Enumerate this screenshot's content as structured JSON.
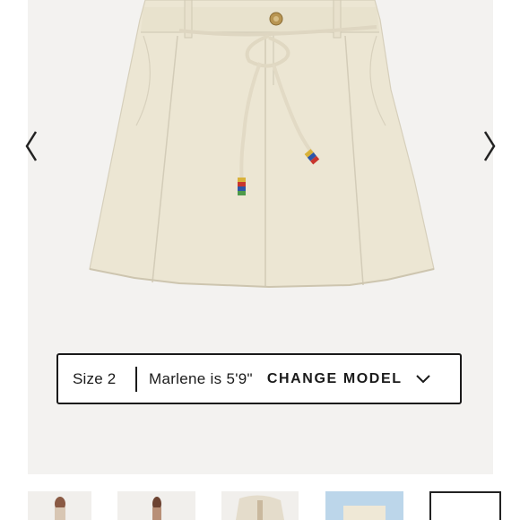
{
  "product": {
    "image_alt": "Cream denim mini skirt with rope tie belt"
  },
  "gallery_nav": {
    "prev_icon": "chevron-left-icon",
    "next_icon": "chevron-right-icon"
  },
  "model_selector": {
    "size_text": "Size 2",
    "model_text": "Marlene is 5'9\"",
    "change_label": "CHANGE MODEL",
    "dropdown_icon": "chevron-down-icon"
  },
  "thumbnails": [
    {
      "name": "thumb-1",
      "active": false
    },
    {
      "name": "thumb-2",
      "active": false
    },
    {
      "name": "thumb-3",
      "active": false
    },
    {
      "name": "thumb-4",
      "active": false
    },
    {
      "name": "thumb-5",
      "active": true
    }
  ],
  "colors": {
    "skirt": "#ece6d3",
    "gallery_bg": "#f3f2f0",
    "border": "#1a1a1a"
  }
}
